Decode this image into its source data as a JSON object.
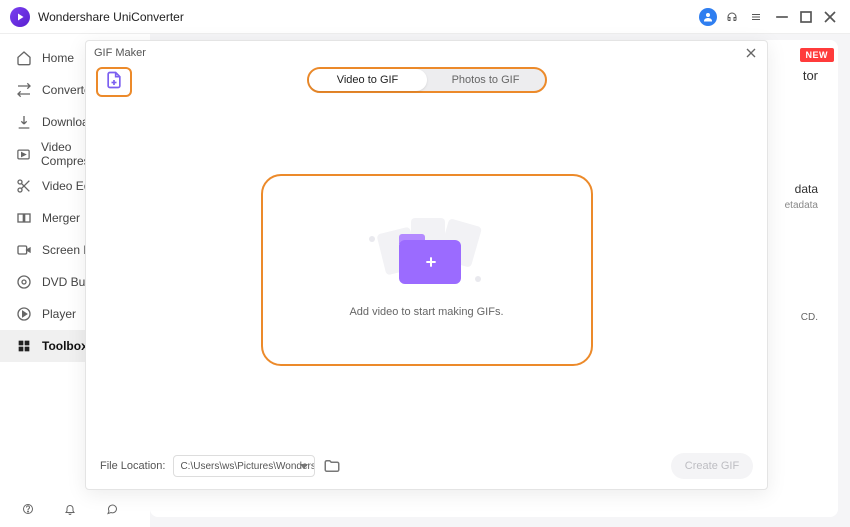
{
  "titlebar": {
    "app_name": "Wondershare UniConverter"
  },
  "sidebar": {
    "items": [
      {
        "label": "Home"
      },
      {
        "label": "Converter"
      },
      {
        "label": "Downloader"
      },
      {
        "label": "Video Compressor"
      },
      {
        "label": "Video Editor"
      },
      {
        "label": "Merger"
      },
      {
        "label": "Screen Recorder"
      },
      {
        "label": "DVD Burner"
      },
      {
        "label": "Player"
      },
      {
        "label": "Toolbox"
      }
    ]
  },
  "background": {
    "badge": "NEW",
    "peek1": "tor",
    "peek2": "data",
    "peek3": "etadata",
    "peek4": "CD."
  },
  "modal": {
    "title": "GIF Maker",
    "tabs": {
      "video": "Video to GIF",
      "photos": "Photos to GIF"
    },
    "drop_hint": "Add video to start making GIFs.",
    "footer": {
      "location_label": "File Location:",
      "location_value": "C:\\Users\\ws\\Pictures\\Wondershare UniConverter",
      "create_label": "Create GIF"
    }
  }
}
